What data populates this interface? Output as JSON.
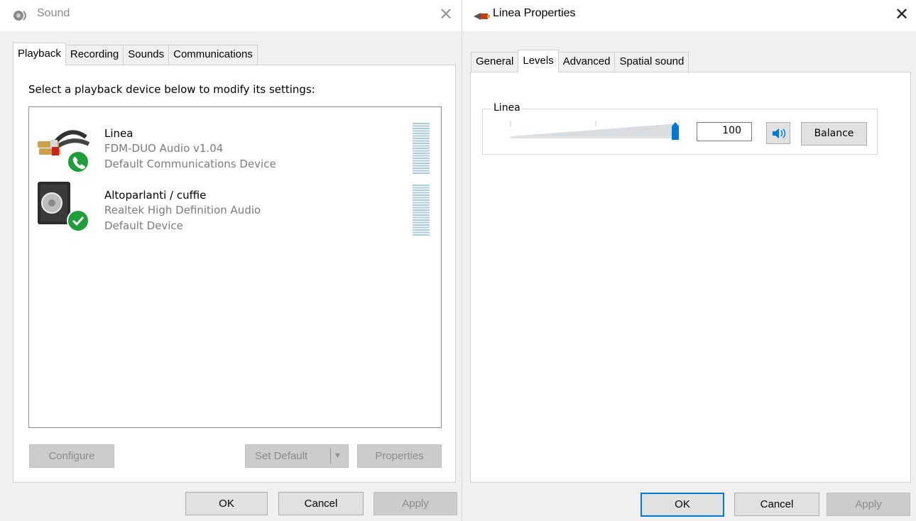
{
  "sound_window": {
    "title": "Sound",
    "tabs": [
      "Playback",
      "Recording",
      "Sounds",
      "Communications"
    ],
    "selected_tab": "Playback",
    "instruction": "Select a playback device below to modify its settings:",
    "devices": [
      {
        "name": "Linea",
        "driver": "FDM-DUO Audio v1.04",
        "status": "Default Communications Device",
        "icon": "rca-cable-icon",
        "badge": "phone-badge-icon"
      },
      {
        "name": "Altoparlanti / cuffie",
        "driver": "Realtek High Definition Audio",
        "status": "Default Device",
        "icon": "speaker-icon",
        "badge": "check-badge-icon"
      }
    ],
    "buttons": {
      "configure": "Configure",
      "set_default": "Set Default",
      "properties": "Properties"
    },
    "footer": {
      "ok": "OK",
      "cancel": "Cancel",
      "apply": "Apply"
    }
  },
  "properties_window": {
    "title": "Linea Properties",
    "tabs": [
      "General",
      "Levels",
      "Advanced",
      "Spatial sound"
    ],
    "selected_tab": "Levels",
    "level_group": {
      "label": "Linea",
      "value": "100",
      "slider_fraction": 1.0,
      "balance_label": "Balance"
    },
    "footer": {
      "ok": "OK",
      "cancel": "Cancel",
      "apply": "Apply"
    }
  },
  "colors": {
    "accent": "#0078d7",
    "check_green": "#1e9e3a",
    "meter_blue": "#a8cbe0"
  }
}
